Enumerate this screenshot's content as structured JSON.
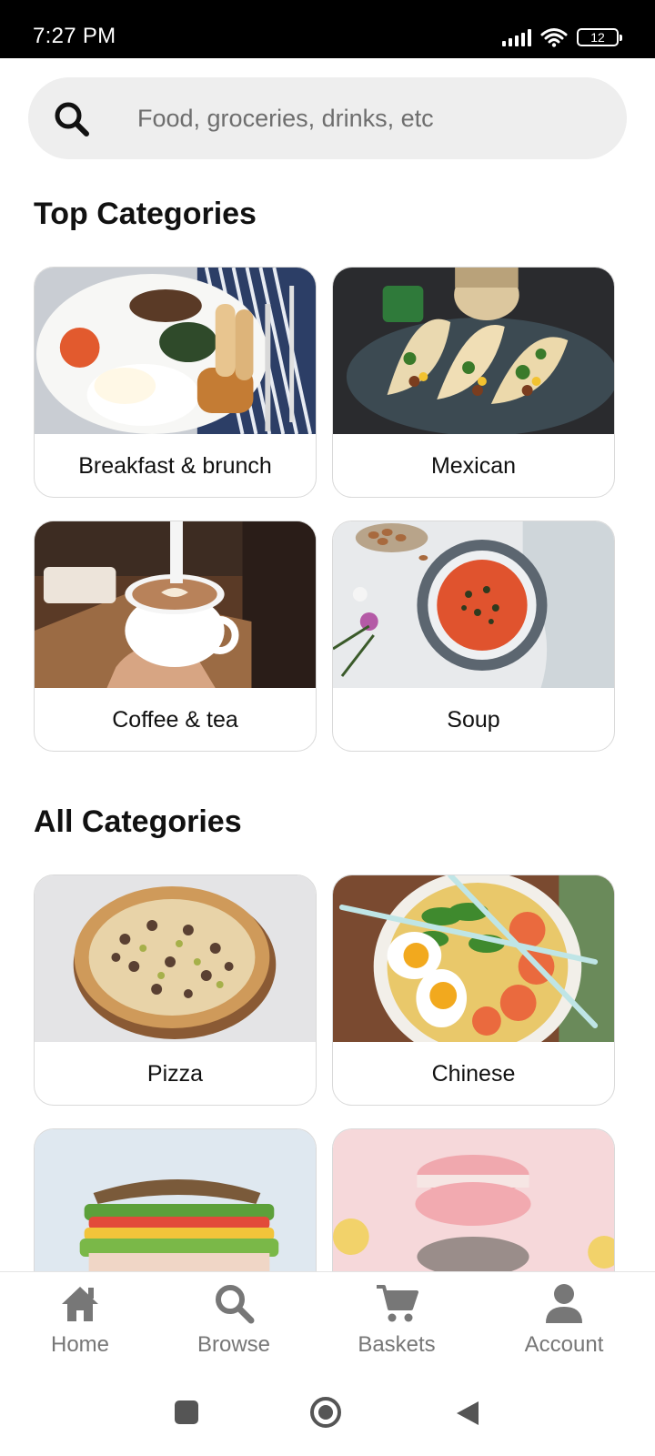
{
  "status_bar": {
    "time": "7:27 PM",
    "battery": "12",
    "icons": [
      "signal-icon",
      "wifi-icon",
      "battery-icon"
    ]
  },
  "search": {
    "placeholder": "Food, groceries, drinks, etc",
    "icon": "search-icon"
  },
  "top_categories": {
    "title": "Top Categories",
    "items": [
      {
        "label": "Breakfast & brunch",
        "image": "breakfast-plate"
      },
      {
        "label": "Mexican",
        "image": "tacos"
      },
      {
        "label": "Coffee & tea",
        "image": "latte-cup"
      },
      {
        "label": "Soup",
        "image": "tomato-soup"
      }
    ]
  },
  "all_categories": {
    "title": "All Categories",
    "items": [
      {
        "label": "Pizza",
        "image": "pizza"
      },
      {
        "label": "Chinese",
        "image": "ramen-bowl"
      },
      {
        "label": "",
        "image": "sandwich"
      },
      {
        "label": "",
        "image": "macarons"
      }
    ]
  },
  "bottom_nav": {
    "items": [
      {
        "label": "Home",
        "icon": "home-icon"
      },
      {
        "label": "Browse",
        "icon": "search-icon"
      },
      {
        "label": "Baskets",
        "icon": "cart-icon"
      },
      {
        "label": "Account",
        "icon": "user-icon"
      }
    ]
  },
  "system_nav": {
    "icons": [
      "recents-icon",
      "home-circle-icon",
      "back-icon"
    ]
  },
  "colors": {
    "search_bg": "#eeeeee",
    "nav_icon": "#777777",
    "card_border": "#d9d9d9"
  }
}
